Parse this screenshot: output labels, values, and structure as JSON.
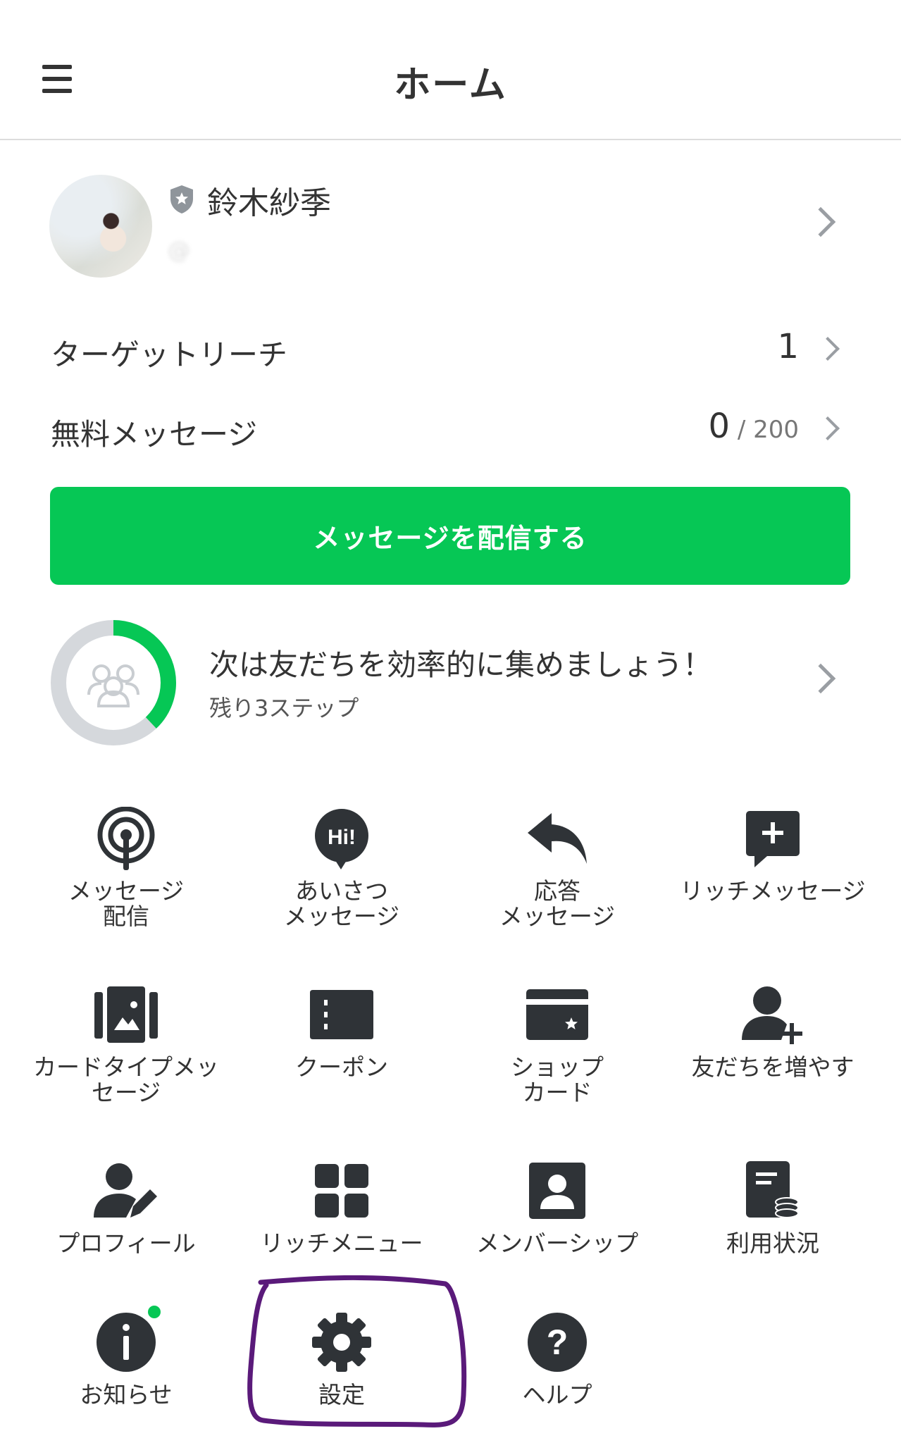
{
  "header": {
    "title": "ホーム",
    "menu_icon": "hamburger-icon"
  },
  "profile": {
    "name": "鈴木紗季",
    "handle": "@",
    "badge_icon": "shield-star-icon"
  },
  "stats": [
    {
      "label": "ターゲットリーチ",
      "value": "1",
      "sub": ""
    },
    {
      "label": "無料メッセージ",
      "value": "0",
      "sub": " / 200"
    }
  ],
  "cta": {
    "label": "メッセージを配信する",
    "color": "#06c755"
  },
  "progress": {
    "title": "次は友だちを効率的に集めましょう！",
    "subtitle": "残り3ステップ",
    "completion": 0.38,
    "accent": "#06c755"
  },
  "menu": [
    {
      "label": "メッセージ\n配信",
      "icon": "broadcast-icon"
    },
    {
      "label": "あいさつ\nメッセージ",
      "icon": "hi-bubble-icon"
    },
    {
      "label": "応答\nメッセージ",
      "icon": "reply-icon"
    },
    {
      "label": "リッチメッセージ",
      "icon": "rich-message-icon"
    },
    {
      "label": "カードタイプメッ\nセージ",
      "icon": "card-type-icon"
    },
    {
      "label": "クーポン",
      "icon": "coupon-icon"
    },
    {
      "label": "ショップ\nカード",
      "icon": "shop-card-icon"
    },
    {
      "label": "友だちを増やす",
      "icon": "add-friend-icon"
    },
    {
      "label": "プロフィール",
      "icon": "profile-edit-icon"
    },
    {
      "label": "リッチメニュー",
      "icon": "rich-menu-icon"
    },
    {
      "label": "メンバーシップ",
      "icon": "membership-icon"
    },
    {
      "label": "利用状況",
      "icon": "usage-icon"
    },
    {
      "label": "お知らせ",
      "icon": "info-icon",
      "has_new": true
    },
    {
      "label": "設定",
      "icon": "gear-icon"
    },
    {
      "label": "ヘルプ",
      "icon": "help-icon"
    }
  ],
  "annotation_color": "#5a1a7a"
}
